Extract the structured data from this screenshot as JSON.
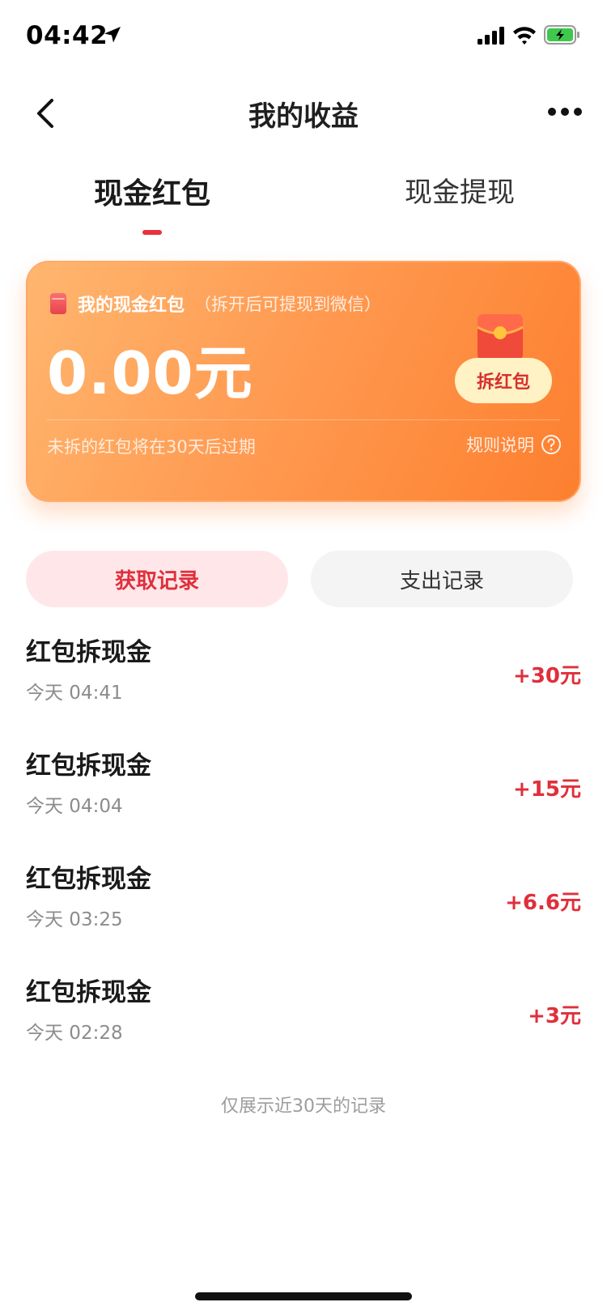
{
  "status_bar": {
    "time": "04:42",
    "icons": [
      "location-arrow-icon",
      "cellular-signal-icon",
      "wifi-icon",
      "battery-charging-icon"
    ]
  },
  "nav": {
    "title": "我的收益",
    "back_icon": "chevron-left-icon",
    "more_icon": "more-dots-icon"
  },
  "tabs": [
    {
      "label": "现金红包",
      "active": true
    },
    {
      "label": "现金提现",
      "active": false
    }
  ],
  "card": {
    "title": "我的现金红包",
    "subtitle": "（拆开后可提现到微信）",
    "amount": "0.00元",
    "open_button": "拆红包",
    "expire_note": "未拆的红包将在30天后过期",
    "rules_link": "规则说明",
    "colors": {
      "gradient_start": "#ffb66f",
      "gradient_end": "#fd7f2f",
      "button_bg": "#fff2c4",
      "button_text": "#d6302f"
    }
  },
  "segments": [
    {
      "label": "获取记录",
      "active": true
    },
    {
      "label": "支出记录",
      "active": false
    }
  ],
  "records": [
    {
      "title": "红包拆现金",
      "time": "今天 04:41",
      "amount": "+30元"
    },
    {
      "title": "红包拆现金",
      "time": "今天 04:04",
      "amount": "+15元"
    },
    {
      "title": "红包拆现金",
      "time": "今天 03:25",
      "amount": "+6.6元"
    },
    {
      "title": "红包拆现金",
      "time": "今天 02:28",
      "amount": "+3元"
    }
  ],
  "footer_note": "仅展示近30天的记录",
  "accent_color": "#e02f3b"
}
